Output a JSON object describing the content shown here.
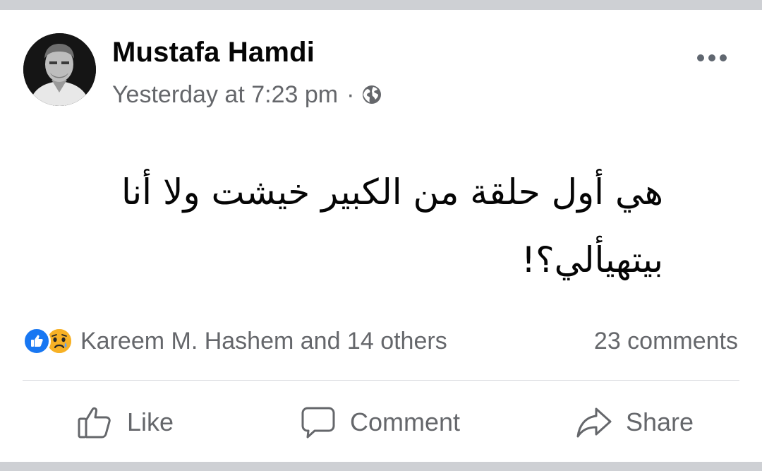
{
  "post": {
    "author": "Mustafa Hamdi",
    "timestamp": "Yesterday at 7:23 pm",
    "separator": "·",
    "privacy_icon": "globe-icon",
    "text": "هي أول حلقة من الكبير خيشت ولا أنا بيتهيألي؟!"
  },
  "engagement": {
    "reaction_icons": [
      "like-reaction-icon",
      "sad-reaction-icon"
    ],
    "reactors": "Kareem M. Hashem and 14 others",
    "comments": "23 comments"
  },
  "actions": {
    "like": "Like",
    "comment": "Comment",
    "share": "Share"
  },
  "colors": {
    "background": "#ced0d4",
    "card": "#ffffff",
    "text_primary": "#050505",
    "text_secondary": "#65676b",
    "like_blue": "#1877f2",
    "sad_yellow": "#f7b125"
  }
}
